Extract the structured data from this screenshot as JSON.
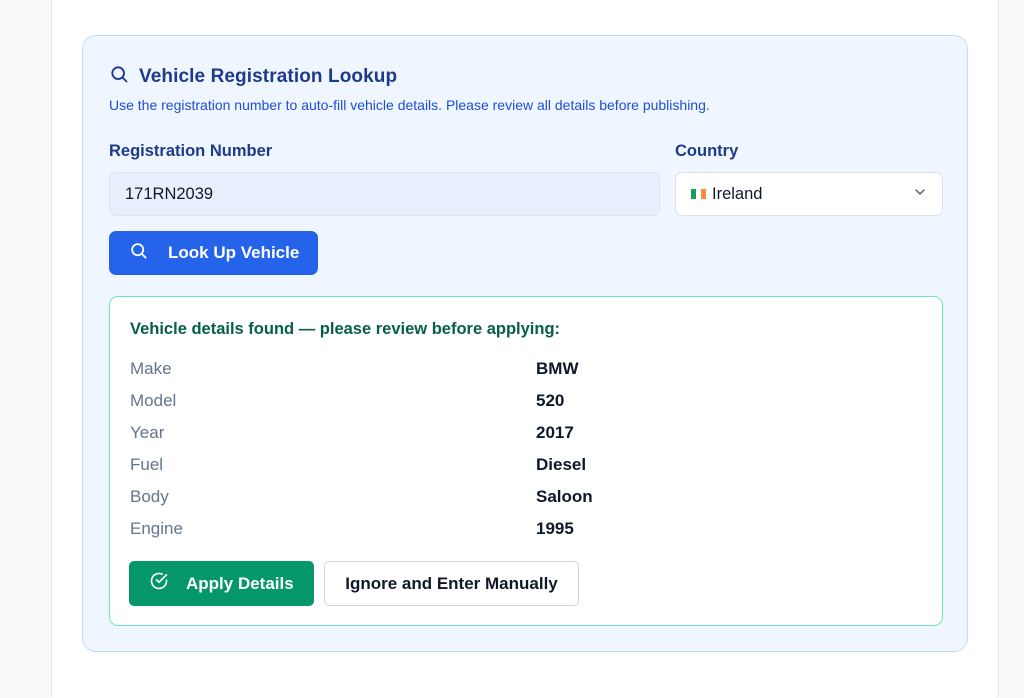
{
  "lookup": {
    "title": "Vehicle Registration Lookup",
    "subtitle": "Use the registration number to auto-fill vehicle details. Please review all details before publishing.",
    "registration_label": "Registration Number",
    "registration_value": "171RN2039",
    "country_label": "Country",
    "country_value": "Ireland",
    "lookup_button_label": "Look Up Vehicle"
  },
  "result": {
    "heading": "Vehicle details found — please review before applying:",
    "details": [
      {
        "label": "Make",
        "value": "BMW"
      },
      {
        "label": "Model",
        "value": "520"
      },
      {
        "label": "Year",
        "value": "2017"
      },
      {
        "label": "Fuel",
        "value": "Diesel"
      },
      {
        "label": "Body",
        "value": "Saloon"
      },
      {
        "label": "Engine",
        "value": "1995"
      }
    ],
    "apply_label": "Apply Details",
    "ignore_label": "Ignore and Enter Manually"
  },
  "icons": {
    "title": "search-icon",
    "lookup": "search-icon",
    "country": "chevron-down-icon",
    "apply": "check-circle-icon"
  },
  "colors": {
    "primary": "#2563eb",
    "success": "#059669",
    "success_border": "#6ee7b7",
    "panel_bg": "#eff6ff",
    "heading": "#1e3a8a"
  }
}
